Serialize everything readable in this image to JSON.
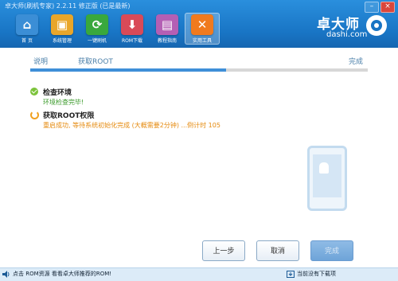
{
  "window": {
    "title": "卓大师(刷机专家) 2.2.11 修正版 (已是最新)",
    "minimize_glyph": "–",
    "close_glyph": "×"
  },
  "toolbar": {
    "items": [
      {
        "label": "首 页",
        "icon": "home-icon",
        "color": "#3b8ed6",
        "glyph": "⌂"
      },
      {
        "label": "系统管理",
        "icon": "gift-box-icon",
        "color": "#e9a62a",
        "glyph": "▣"
      },
      {
        "label": "一键刷机",
        "icon": "refresh-icon",
        "color": "#39a83d",
        "glyph": "⟳"
      },
      {
        "label": "ROM下载",
        "icon": "cart-icon",
        "color": "#d94a58",
        "glyph": "⬇"
      },
      {
        "label": "教程指南",
        "icon": "book-icon",
        "color": "#b45fb4",
        "glyph": "▤"
      },
      {
        "label": "实用工具",
        "icon": "tools-icon",
        "color": "#f07a1e",
        "glyph": "✕"
      }
    ],
    "active_index": 5
  },
  "brand": {
    "name_cn": "卓大师",
    "name_en": "dashi.com"
  },
  "steps": {
    "labels": [
      "说明",
      "获取ROOT",
      "完成"
    ],
    "progress": 0.58
  },
  "tasks": [
    {
      "title": "检查环境",
      "status_text": "环境检查完毕!",
      "state": "done"
    },
    {
      "title": "获取ROOT权限",
      "status_text": "重启成功, 等待系统初始化完成 (大概需要2分钟) ...倒计时 105",
      "state": "in-progress"
    }
  ],
  "buttons": {
    "prev": "上一步",
    "cancel": "取消",
    "next": "完成"
  },
  "status_bar": {
    "left_text": "点击 ROM资源 看看卓大师推荐的ROM!",
    "right_text": "当前没有下载项"
  },
  "colors": {
    "titlebar": "#1874c4",
    "progress": "#3f8fd8",
    "success": "#7cc33b",
    "pending": "#e58a0e"
  }
}
